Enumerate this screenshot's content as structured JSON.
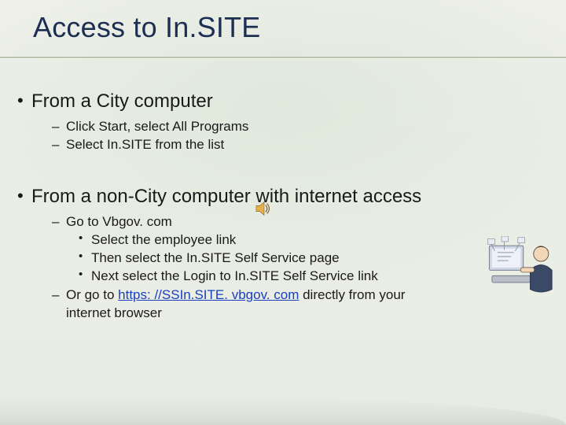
{
  "title": "Access to In.SITE",
  "section1": {
    "heading": "From a City computer",
    "sub": [
      "Click Start, select All Programs",
      "Select In.SITE from the list"
    ]
  },
  "section2": {
    "heading": "From a non-City computer with internet access",
    "goLine": "Go to Vbgov. com",
    "steps": [
      "Select the employee link",
      "Then select the In.SITE Self Service page",
      "Next select the Login to In.SITE Self Service link"
    ],
    "orPrefix": "Or go to ",
    "link": "https: //SSIn.SITE. vbgov. com",
    "orSuffix": " directly from your",
    "orLine2": "internet browser"
  }
}
